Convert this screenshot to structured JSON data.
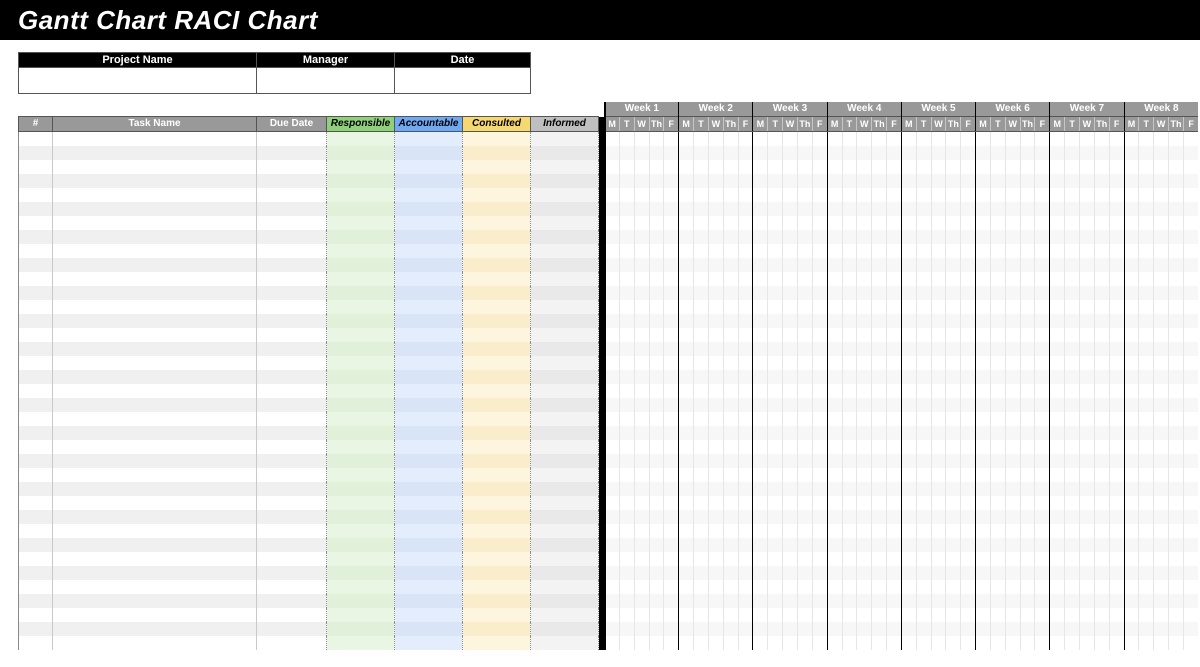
{
  "title": "Gantt Chart RACI Chart",
  "info_headers": {
    "project": "Project Name",
    "manager": "Manager",
    "date": "Date"
  },
  "info_values": {
    "project": "",
    "manager": "",
    "date": ""
  },
  "columns": {
    "num": "#",
    "task": "Task Name",
    "due": "Due Date",
    "responsible": "Responsible",
    "accountable": "Accountable",
    "consulted": "Consulted",
    "informed": "Informed"
  },
  "weeks": [
    "Week 1",
    "Week 2",
    "Week 3",
    "Week 4",
    "Week 5",
    "Week 6",
    "Week 7",
    "Week 8"
  ],
  "days": [
    "M",
    "T",
    "W",
    "Th",
    "F"
  ],
  "row_count": 37,
  "chart_data": {
    "type": "table",
    "title": "Gantt Chart RACI Chart",
    "weeks": 8,
    "days_per_week": [
      "M",
      "T",
      "W",
      "Th",
      "F"
    ],
    "raci_columns": [
      "Responsible",
      "Accountable",
      "Consulted",
      "Informed"
    ],
    "tasks": []
  }
}
